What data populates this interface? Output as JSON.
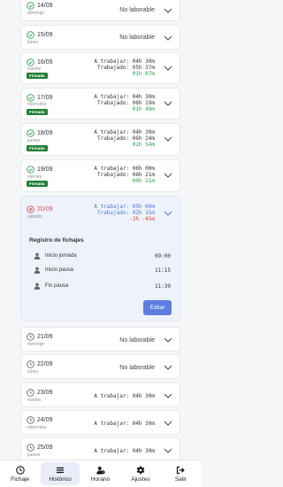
{
  "days": [
    {
      "date": "14/09",
      "weekday": "domingo",
      "status": "check",
      "no_laborable": "No laborable"
    },
    {
      "date": "15/09",
      "weekday": "lunes",
      "status": "check",
      "no_laborable": "No laborable"
    },
    {
      "date": "16/09",
      "weekday": "martes",
      "status": "check",
      "badge": "Firmada",
      "a_trabajar": "A trabajar: 04h 30m",
      "trabajado": "Trabajado: 05h 37m",
      "diff": "01h 07m"
    },
    {
      "date": "17/09",
      "weekday": "miércoles",
      "status": "check",
      "badge": "Firmada",
      "a_trabajar": "A trabajar: 04h 30m",
      "trabajado": "Trabajado: 06h 19m",
      "diff": "01h 49m"
    },
    {
      "date": "18/09",
      "weekday": "jueves",
      "status": "check",
      "badge": "Firmada",
      "a_trabajar": "A trabajar: 04h 30m",
      "trabajado": "Trabajado: 06h 24m",
      "diff": "01h 54m"
    },
    {
      "date": "19/09",
      "weekday": "viernes",
      "status": "check",
      "badge": "Firmada",
      "a_trabajar": "A trabajar: 06h 00m",
      "trabajado": "Trabajado: 06h 21m",
      "diff": "00h 21m"
    },
    {
      "date": "20/09",
      "weekday": "sábado",
      "status": "error",
      "a_trabajar": "A trabajar: 05h 00m",
      "trabajado": "Trabajado: 02h 15m",
      "diff": "-3h -45m"
    },
    {
      "date": "21/09",
      "weekday": "domingo",
      "status": "clock",
      "no_laborable": "No laborable"
    },
    {
      "date": "22/09",
      "weekday": "lunes",
      "status": "clock",
      "no_laborable": "No laborable"
    },
    {
      "date": "23/09",
      "weekday": "martes",
      "status": "clock",
      "a_trabajar": "A trabajar: 04h 30m"
    },
    {
      "date": "24/09",
      "weekday": "miércoles",
      "status": "clock",
      "a_trabajar": "A trabajar: 04h 30m"
    },
    {
      "date": "25/09",
      "weekday": "jueves",
      "status": "clock",
      "a_trabajar": "A trabajar: 04h 30m"
    }
  ],
  "registro": {
    "title": "Registro de fichajes",
    "items": [
      {
        "label": "Inicio jornada",
        "time": "09:00"
      },
      {
        "label": "Inicio pausa",
        "time": "11:15"
      },
      {
        "label": "Fin pausa",
        "time": "11:30"
      }
    ],
    "edit_label": "Editar"
  },
  "nav": [
    {
      "label": "Fichaje",
      "icon": "clock-icon"
    },
    {
      "label": "Histórico",
      "icon": "list-icon",
      "active": true
    },
    {
      "label": "Horario",
      "icon": "user-clock-icon"
    },
    {
      "label": "Ajustes",
      "icon": "gear-icon"
    },
    {
      "label": "Salir",
      "icon": "logout-icon"
    }
  ],
  "colors": {
    "firmada": "#1e7e34",
    "positive": "#22a34a",
    "negative": "#e0423c",
    "accent": "#5b7fe0",
    "blue_text": "#4a7ad6"
  }
}
